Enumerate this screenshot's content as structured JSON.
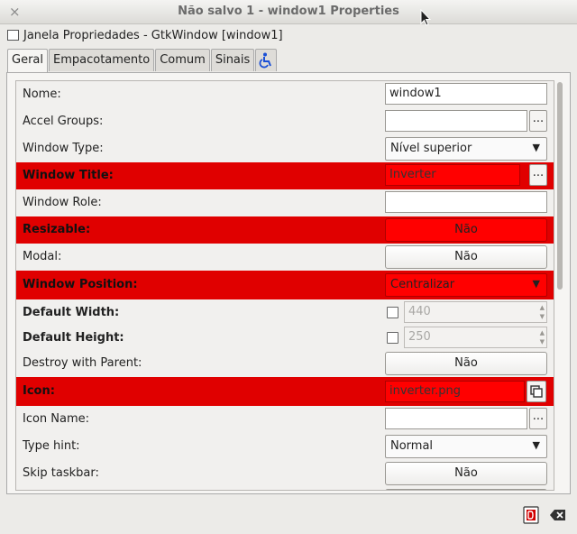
{
  "window": {
    "title": "Não salvo 1 - window1 Properties",
    "close_glyph": "×"
  },
  "header": {
    "object_label": "Janela Propriedades - GtkWindow [window1]"
  },
  "tabs": [
    {
      "label": "Geral",
      "active": true
    },
    {
      "label": "Empacotamento",
      "active": false
    },
    {
      "label": "Comum",
      "active": false
    },
    {
      "label": "Sinais",
      "active": false
    },
    {
      "label": "",
      "icon": "accessibility-icon",
      "active": false
    }
  ],
  "colors": {
    "highlight": "#e00000",
    "highlight_field": "#ff0000",
    "accessibility_icon": "#1a4fd6"
  },
  "properties": {
    "name": {
      "label": "Nome:",
      "value": "window1"
    },
    "accel_groups": {
      "label": "Accel Groups:",
      "value": "",
      "button": "..."
    },
    "window_type": {
      "label": "Window Type:",
      "value": "Nível superior"
    },
    "window_title": {
      "label": "Window Title:",
      "value": "Inverter",
      "button": "...",
      "highlighted": true
    },
    "window_role": {
      "label": "Window Role:",
      "value": ""
    },
    "resizable": {
      "label": "Resizable:",
      "value": "Não",
      "highlighted": true
    },
    "modal": {
      "label": "Modal:",
      "value": "Não"
    },
    "window_position": {
      "label": "Window Position:",
      "value": "Centralizar",
      "highlighted": true
    },
    "default_width": {
      "label": "Default Width:",
      "value": "440",
      "checked": false
    },
    "default_height": {
      "label": "Default Height:",
      "value": "250",
      "checked": false
    },
    "destroy_with_parent": {
      "label": "Destroy with Parent:",
      "value": "Não"
    },
    "icon": {
      "label": "Icon:",
      "value": "inverter.png",
      "highlighted": true
    },
    "icon_name": {
      "label": "Icon Name:",
      "value": "",
      "button": "..."
    },
    "type_hint": {
      "label": "Type hint:",
      "value": "Normal"
    },
    "skip_taskbar": {
      "label": "Skip taskbar:",
      "value": "Não"
    }
  },
  "dropdown_arrow": "▼",
  "spin_arrows": {
    "up": "▲",
    "down": "▼"
  },
  "bottom_icons": [
    "debug-icon",
    "clear-icon"
  ]
}
